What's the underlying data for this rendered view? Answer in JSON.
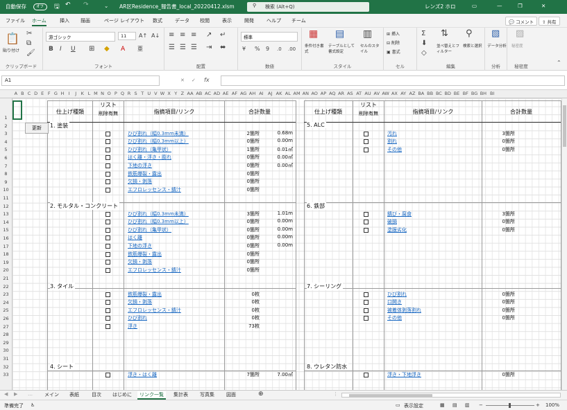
{
  "titlebar": {
    "autosave_label": "自動保存",
    "autosave_toggle": "オフ",
    "filename": "AR区Residence_報告書_local_20220412.xlsm",
    "search_placeholder": "検索 (Alt+Q)",
    "user_name": "レンズ2 ホロ"
  },
  "menu": {
    "tabs": [
      "ファイル",
      "ホーム",
      "挿入",
      "描画",
      "ページ レイアウト",
      "数式",
      "データ",
      "校閲",
      "表示",
      "開発",
      "ヘルプ",
      "チーム"
    ],
    "active_tab": "ホーム",
    "comment_button": "コメント",
    "share_button": "共有"
  },
  "ribbon": {
    "clipboard": {
      "label": "クリップボード",
      "paste": "貼り付け"
    },
    "font": {
      "label": "フォント",
      "font_name": "游ゴシック",
      "font_size": "11",
      "bold": "B",
      "italic": "I",
      "underline": "U"
    },
    "alignment": {
      "label": "配置"
    },
    "number": {
      "label": "数値",
      "format": "標準",
      "percent": "%",
      "comma": "9"
    },
    "styles": {
      "label": "スタイル",
      "conditional": "条件付き書式",
      "table": "テーブルとして書式設定",
      "cell": "セルのスタイル"
    },
    "cells": {
      "label": "セル",
      "insert": "挿入",
      "delete": "削除",
      "format": "書式"
    },
    "editing": {
      "label": "編集",
      "sort": "並べ替えとフィルター",
      "find": "検索と選択"
    },
    "analysis": {
      "label": "分析",
      "data_analysis": "データ分析"
    },
    "sensitivity": {
      "label": "秘密度",
      "sensitivity_btn": "秘密度"
    }
  },
  "formula_bar": {
    "name_box": "A1",
    "cancel": "✕",
    "enter": "✓",
    "fx": "fx",
    "value": ""
  },
  "columns": [
    "A",
    "B",
    "C",
    "D",
    "E",
    "F",
    "G",
    "H",
    "I",
    "J",
    "K",
    "L",
    "M",
    "N",
    "O",
    "P",
    "Q",
    "R",
    "S",
    "T",
    "U",
    "V",
    "W",
    "X",
    "Y",
    "Z",
    "AA",
    "AB",
    "AC",
    "AD",
    "AE",
    "AF",
    "AG",
    "AH",
    "AI",
    "AJ",
    "AK",
    "AL",
    "AM",
    "AN",
    "AO",
    "AP",
    "AQ",
    "AR",
    "AS",
    "AT",
    "AU",
    "AV",
    "AW",
    "AX",
    "AY",
    "AZ",
    "BA",
    "BB",
    "BC",
    "BD",
    "BE",
    "BF",
    "BG",
    "BH",
    "BI"
  ],
  "rows": [
    "1",
    "2",
    "3",
    "4",
    "5",
    "6",
    "7",
    "8",
    "9",
    "10",
    "11",
    "12",
    "13",
    "14",
    "15",
    "16",
    "17",
    "18",
    "19",
    "20",
    "21",
    "22",
    "23",
    "24",
    "25",
    "26",
    "27",
    "28",
    "29",
    "30",
    "31",
    "32",
    "33"
  ],
  "update_button": "更新",
  "table_headers": {
    "finish_type": "仕上げ種類",
    "list": "リスト",
    "delete_flag": "削除有無",
    "items_link": "指摘項目/リンク",
    "total_count": "合計数量"
  },
  "sections_left": [
    {
      "title": "1. 塗装",
      "items": [
        {
          "link": "ひび割れ（幅0.3mm未満）",
          "count": "2箇所",
          "qty": "0.68m"
        },
        {
          "link": "ひび割れ（幅0.3mm以上）",
          "count": "0箇所",
          "qty": "0.00m"
        },
        {
          "link": "ひび割れ（亀甲状）",
          "count": "1箇所",
          "qty": "0.01㎡"
        },
        {
          "link": "はく離・浮き・膨れ",
          "count": "0箇所",
          "qty": "0.00㎡"
        },
        {
          "link": "下地の浮き",
          "count": "0箇所",
          "qty": "0.00㎡"
        },
        {
          "link": "鉄筋爆裂・露出",
          "count": "0箇所",
          "qty": ""
        },
        {
          "link": "欠損・剥落",
          "count": "0箇所",
          "qty": ""
        },
        {
          "link": "エフロレッセンス・錆汁",
          "count": "0箇所",
          "qty": ""
        }
      ]
    },
    {
      "title": "2. モルタル・コンクリート",
      "items": [
        {
          "link": "ひび割れ（幅0.3mm未満）",
          "count": "3箇所",
          "qty": "1.01m"
        },
        {
          "link": "ひび割れ（幅0.3mm以上）",
          "count": "0箇所",
          "qty": "0.00m"
        },
        {
          "link": "ひび割れ（亀甲状）",
          "count": "0箇所",
          "qty": "0.00m"
        },
        {
          "link": "はく離",
          "count": "0箇所",
          "qty": "0.00m"
        },
        {
          "link": "下地の浮き",
          "count": "0箇所",
          "qty": "0.00m"
        },
        {
          "link": "鉄筋爆裂・露出",
          "count": "0箇所",
          "qty": ""
        },
        {
          "link": "欠損・剥落",
          "count": "0箇所",
          "qty": ""
        },
        {
          "link": "エフロレッセンス・錆汁",
          "count": "0箇所",
          "qty": ""
        }
      ]
    },
    {
      "title": "3. タイル",
      "items": [
        {
          "link": "鉄筋爆裂・露出",
          "count": "0枚",
          "qty": ""
        },
        {
          "link": "欠損・剥落",
          "count": "0枚",
          "qty": ""
        },
        {
          "link": "エフロレッセンス・錆汁",
          "count": "0枚",
          "qty": ""
        },
        {
          "link": "ひび割れ",
          "count": "0枚",
          "qty": ""
        },
        {
          "link": "浮き",
          "count": "73枚",
          "qty": ""
        }
      ]
    },
    {
      "title": "4. シート",
      "items": [
        {
          "link": "浮き・はく離",
          "count": "7箇所",
          "qty": "7.00㎡"
        }
      ]
    }
  ],
  "sections_right": [
    {
      "title": "5. ALC",
      "items": [
        {
          "link": "汚れ",
          "count": "3箇所"
        },
        {
          "link": "割れ",
          "count": "0箇所"
        },
        {
          "link": "その他",
          "count": "0箇所"
        }
      ]
    },
    {
      "title": "6. 鉄部",
      "items": [
        {
          "link": "錆び・腐食",
          "count": "3箇所"
        },
        {
          "link": "破損",
          "count": "0箇所"
        },
        {
          "link": "塗膜劣化",
          "count": "0箇所"
        }
      ]
    },
    {
      "title": "7. シーリング",
      "items": [
        {
          "link": "ひび割れ",
          "count": "0箇所"
        },
        {
          "link": "口開き",
          "count": "0箇所"
        },
        {
          "link": "被着体剥落割れ",
          "count": "0箇所"
        },
        {
          "link": "その他",
          "count": "0箇所"
        }
      ]
    },
    {
      "title": "8. ウレタン防水",
      "items": [
        {
          "link": "浮き・下地浮き",
          "count": "0箇所"
        }
      ]
    }
  ],
  "sheet_tabs": [
    "メイン",
    "表紙",
    "目次",
    "はじめに",
    "リンク一覧",
    "集計表",
    "写真集",
    "図面"
  ],
  "active_sheet": "リンク一覧",
  "status": {
    "ready": "準備完了",
    "display_settings": "表示設定",
    "zoom": "100%"
  },
  "colors": {
    "excel_green": "#217346",
    "link_blue": "#1565c0"
  }
}
